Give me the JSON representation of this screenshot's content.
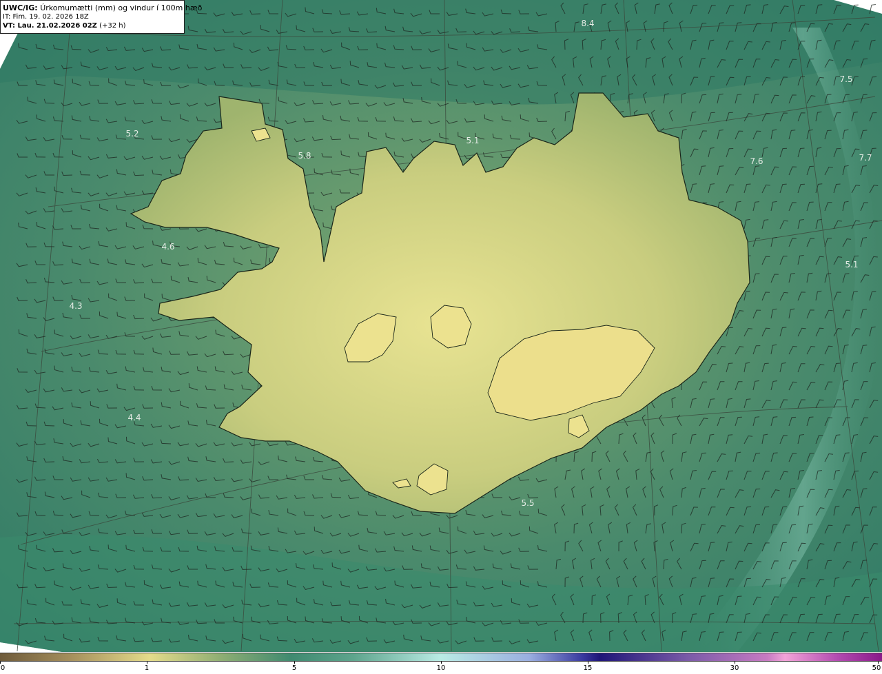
{
  "title": {
    "model": "UWC/IG:",
    "description": "Úrkomumætti (mm) og vindur í 100m hæð",
    "it_label": "IT:",
    "it_value": "Fim. 19. 02. 2026 18Z",
    "vt_label": "VT: Lau. 21.02.2026 02Z",
    "vt_lead": "(+32 h)"
  },
  "colors": {
    "ocean_low": "#2e7a63",
    "ocean_mid": "#3f8a70",
    "ocean_high": "#6aa88f",
    "land": "#b9c474",
    "land_high": "#e6e192",
    "coast": "#1a2a1a",
    "grid": "#3a4a3a"
  },
  "colorbar": {
    "ticks": [
      {
        "label": "0",
        "value": 0
      },
      {
        "label": "1",
        "value": 1
      },
      {
        "label": "5",
        "value": 5
      },
      {
        "label": "10",
        "value": 10
      },
      {
        "label": "15",
        "value": 15
      },
      {
        "label": "30",
        "value": 30
      },
      {
        "label": "50",
        "value": 50
      }
    ]
  },
  "value_labels": [
    {
      "text": "5.2",
      "id": "w-west-north"
    },
    {
      "text": "5.8",
      "id": "westfjords-east"
    },
    {
      "text": "5.1",
      "id": "north-coast"
    },
    {
      "text": "8.4",
      "id": "north-east-top"
    },
    {
      "text": "7.5",
      "id": "far-east-top"
    },
    {
      "text": "7.6",
      "id": "east-north"
    },
    {
      "text": "7.7",
      "id": "far-east-edge"
    },
    {
      "text": "4.6",
      "id": "west-mid"
    },
    {
      "text": "4.3",
      "id": "west-low"
    },
    {
      "text": "5.1",
      "id": "east-mid"
    },
    {
      "text": "4.4",
      "id": "southwest"
    },
    {
      "text": "5.5",
      "id": "south-coast"
    }
  ]
}
